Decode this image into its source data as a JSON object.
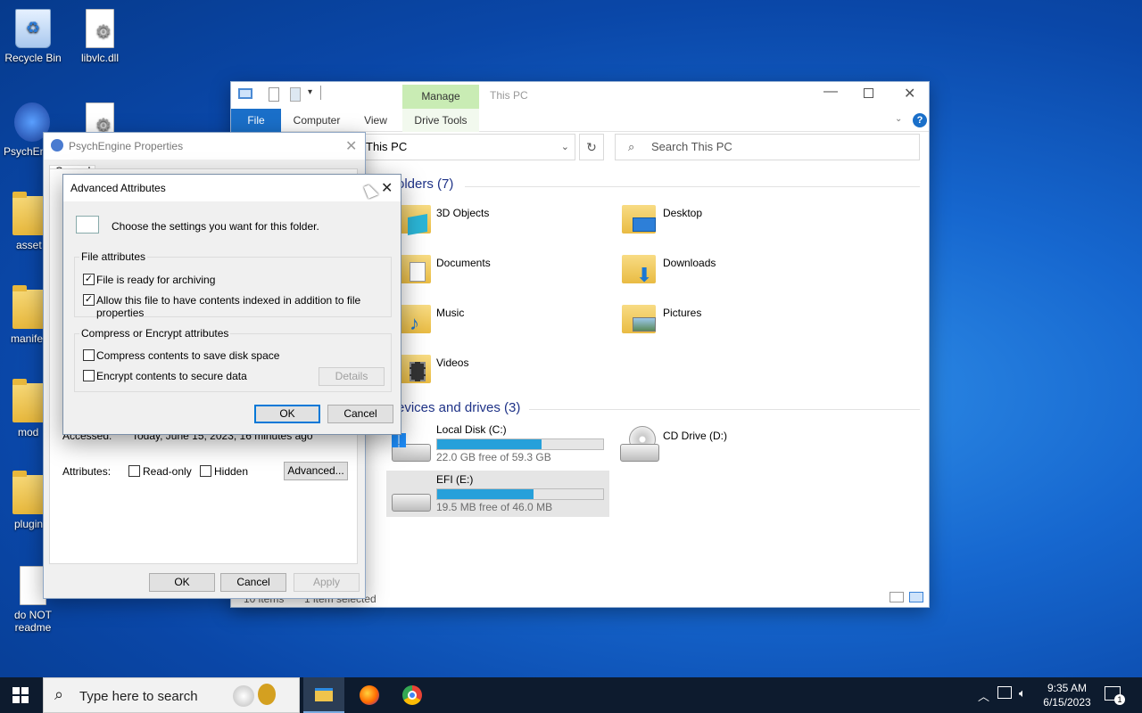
{
  "desktop": {
    "icons": [
      {
        "label": "Recycle Bin"
      },
      {
        "label": "libvlc.dll"
      },
      {
        "label": "PsychEn"
      },
      {
        "label": "asset"
      },
      {
        "label": "manife"
      },
      {
        "label": "mod"
      },
      {
        "label": "plugin"
      },
      {
        "label": "do NOT readme"
      }
    ]
  },
  "explorer": {
    "title": "This PC",
    "manage_tab": "Manage",
    "tabs": [
      "File",
      "Computer",
      "View",
      "Drive Tools"
    ],
    "address": "This PC",
    "search_placeholder": "Search This PC",
    "folders_header": "olders (7)",
    "folders": [
      "3D Objects",
      "Desktop",
      "Documents",
      "Downloads",
      "Music",
      "Pictures",
      "Videos"
    ],
    "drives_header": "evices and drives (3)",
    "drives": [
      {
        "name": "Local Disk (C:)",
        "free": "22.0 GB free of 59.3 GB",
        "used_fraction": 0.63
      },
      {
        "name": "CD Drive (D:)"
      },
      {
        "name": "EFI (E:)",
        "free": "19.5 MB free of 46.0 MB",
        "used_fraction": 0.58
      }
    ],
    "status_items": "10 items",
    "status_selected": "1 item selected"
  },
  "props": {
    "title": "PsychEngine Properties",
    "tab_general": "General",
    "accessed_label": "Accessed:",
    "accessed_value": "Today, June 15, 2023, 16 minutes ago",
    "attributes_label": "Attributes:",
    "readonly_label": "Read-only",
    "hidden_label": "Hidden",
    "advanced_button": "Advanced...",
    "ok": "OK",
    "cancel": "Cancel",
    "apply": "Apply"
  },
  "advanced": {
    "title": "Advanced Attributes",
    "intro": "Choose the settings you want for this folder.",
    "file_attributes": "File attributes",
    "archive_label": "File is ready for archiving",
    "archive_checked": true,
    "index_label": "Allow this file to have contents indexed in addition to file properties",
    "index_checked": true,
    "compress_group": "Compress or Encrypt attributes",
    "compress_label": "Compress contents to save disk space",
    "compress_checked": false,
    "encrypt_label": "Encrypt contents to secure data",
    "encrypt_checked": false,
    "details_button": "Details",
    "ok": "OK",
    "cancel": "Cancel"
  },
  "taskbar": {
    "search_placeholder": "Type here to search",
    "time": "9:35 AM",
    "date": "6/15/2023",
    "notification_count": "1"
  }
}
